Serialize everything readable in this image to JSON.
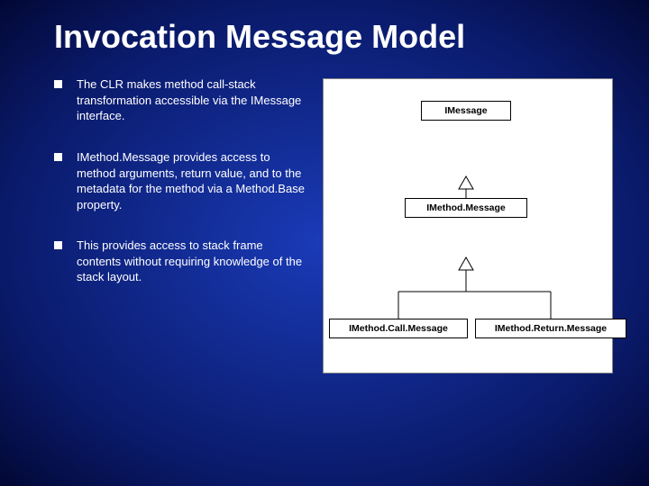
{
  "title": "Invocation Message Model",
  "bullets": [
    "The CLR makes method call-stack transformation accessible via the IMessage interface.",
    "IMethod.Message provides access to method arguments, return value, and to the metadata for the method via a Method.Base property.",
    "This provides access to stack frame contents without requiring knowledge of the stack layout."
  ],
  "diagram": {
    "top": "IMessage",
    "middle": "IMethod.Message",
    "bottomLeft": "IMethod.Call.Message",
    "bottomRight": "IMethod.Return.Message"
  }
}
